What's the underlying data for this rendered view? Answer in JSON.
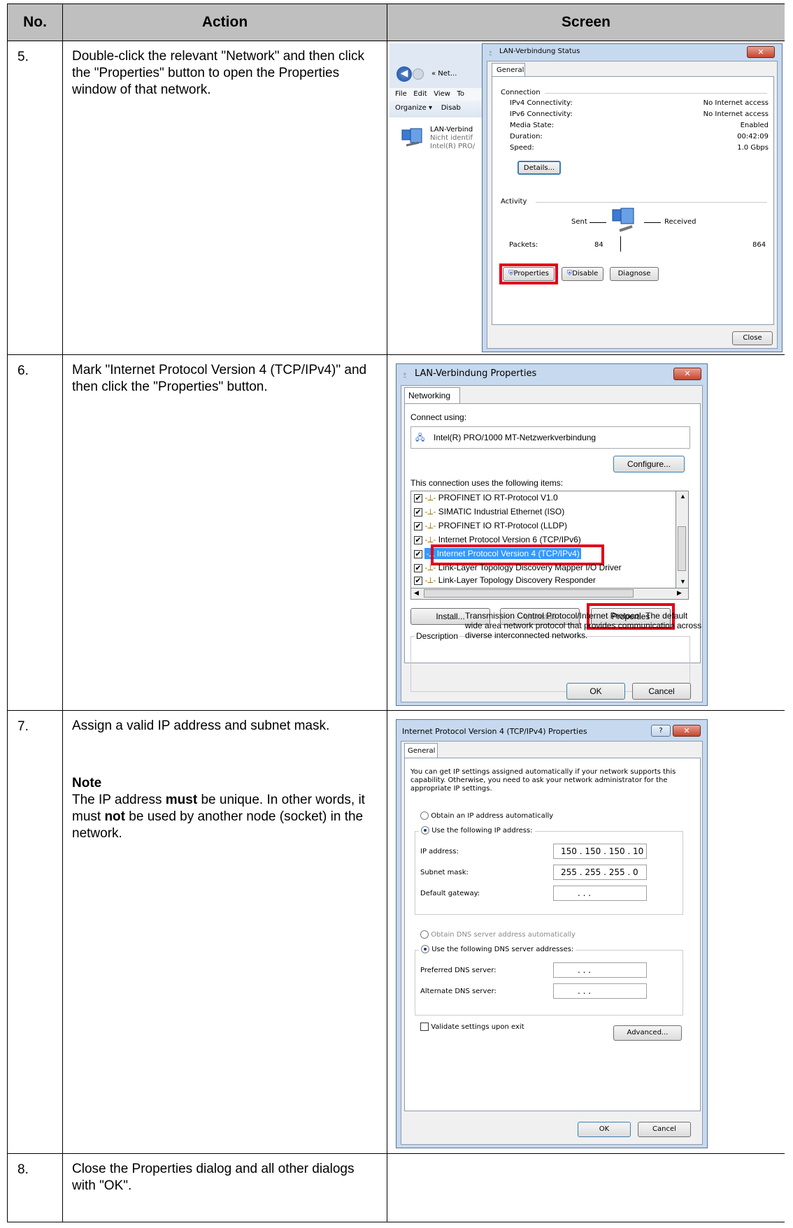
{
  "table": {
    "headers": {
      "no": "No.",
      "action": "Action",
      "screen": "Screen"
    }
  },
  "steps": [
    {
      "no": "5.",
      "action": "Double-click the relevant \"Network\" and then click the \"Properties\" button to open the Properties window of that network."
    },
    {
      "no": "6.",
      "action": "Mark \"Internet Protocol Version 4 (TCP/IPv4)\" and then click the \"Properties\" button."
    },
    {
      "no": "7.",
      "action": "Assign a valid IP address and subnet mask.",
      "note_title": "Note",
      "note_part1": "The IP address ",
      "note_bold1": "must",
      "note_part2": " be unique. In other words, it must ",
      "note_bold2": "not",
      "note_part3": " be used by another node (socket) in the network."
    },
    {
      "no": "8.",
      "action": "Close the Properties dialog and all other dialogs with \"OK\"."
    }
  ],
  "status_dialog": {
    "explorer_crumb": "« Net...",
    "menu": [
      "File",
      "Edit",
      "View",
      "To"
    ],
    "toolbar_organize": "Organize ▾",
    "toolbar_disab": "Disab",
    "adapter_name": "LAN-Verbind",
    "adapter_status": "Nicht identif",
    "adapter_device": "Intel(R) PRO/",
    "title": "LAN-Verbindung Status",
    "tab": "General",
    "connection_group": "Connection",
    "rows": [
      {
        "label": "IPv4 Connectivity:",
        "value": "No Internet access"
      },
      {
        "label": "IPv6 Connectivity:",
        "value": "No Internet access"
      },
      {
        "label": "Media State:",
        "value": "Enabled"
      },
      {
        "label": "Duration:",
        "value": "00:42:09"
      },
      {
        "label": "Speed:",
        "value": "1.0 Gbps"
      }
    ],
    "details_button": "Details...",
    "activity_group": "Activity",
    "sent_label": "Sent",
    "received_label": "Received",
    "packets_label": "Packets:",
    "packets_sent": "84",
    "packets_received": "864",
    "properties_button": "Properties",
    "disable_button": "Disable",
    "diagnose_button": "Diagnose",
    "close_button": "Close"
  },
  "properties_dialog": {
    "title": "LAN-Verbindung Properties",
    "tab": "Networking",
    "connect_using_label": "Connect using:",
    "adapter": "Intel(R) PRO/1000 MT-Netzwerkverbindung",
    "configure_button": "Configure...",
    "items_label": "This connection uses the following items:",
    "items": [
      "PROFINET IO RT-Protocol V1.0",
      "SIMATIC Industrial Ethernet (ISO)",
      "PROFINET IO RT-Protocol (LLDP)",
      "Internet Protocol Version 6 (TCP/IPv6)",
      "Internet Protocol Version 4 (TCP/IPv4)",
      "Link-Layer Topology Discovery Mapper I/O Driver",
      "Link-Layer Topology Discovery Responder"
    ],
    "selected_item_index": 4,
    "install_button": "Install...",
    "uninstall_button": "Uninstall",
    "properties_button": "Properties",
    "description_label": "Description",
    "description_text": "Transmission Control Protocol/Internet Protocol. The default wide area network protocol that provides communication across diverse interconnected networks.",
    "ok_button": "OK",
    "cancel_button": "Cancel"
  },
  "ipv4_dialog": {
    "title": "Internet Protocol Version 4 (TCP/IPv4) Properties",
    "tab": "General",
    "intro": "You can get IP settings assigned automatically if your network supports this capability. Otherwise, you need to ask your network administrator for the appropriate IP settings.",
    "obtain_ip_auto": "Obtain an IP address automatically",
    "use_following_ip": "Use the following IP address:",
    "ip_label": "IP address:",
    "ip_value": "150 . 150 . 150 . 10",
    "subnet_label": "Subnet mask:",
    "subnet_value": "255 . 255 . 255 . 0",
    "gateway_label": "Default gateway:",
    "empty_ip": ".       .       .",
    "obtain_dns_auto": "Obtain DNS server address automatically",
    "use_following_dns": "Use the following DNS server addresses:",
    "preferred_dns_label": "Preferred DNS server:",
    "alternate_dns_label": "Alternate DNS server:",
    "validate_label": "Validate settings upon exit",
    "advanced_button": "Advanced...",
    "ok_button": "OK",
    "cancel_button": "Cancel"
  }
}
